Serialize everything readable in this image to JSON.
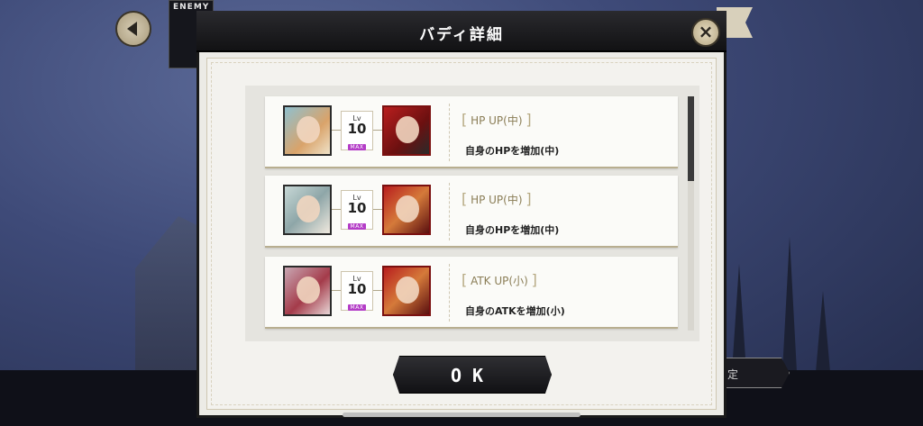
{
  "enemy_label": "ENEMY",
  "dialog": {
    "title": "バディ詳細",
    "close_symbol": "×",
    "ok_label": "OK"
  },
  "side_button_label": "定",
  "buddies": [
    {
      "level_label": "Lv",
      "level": "10",
      "max_badge": "MAX",
      "skill_name": "HP UP(中)",
      "skill_desc": "自身のHPを増加(中)"
    },
    {
      "level_label": "Lv",
      "level": "10",
      "max_badge": "MAX",
      "skill_name": "HP UP(中)",
      "skill_desc": "自身のHPを増加(中)"
    },
    {
      "level_label": "Lv",
      "level": "10",
      "max_badge": "MAX",
      "skill_name": "ATK UP(小)",
      "skill_desc": "自身のATKを増加(小)"
    }
  ],
  "colors": {
    "max_badge": "#b43dc7",
    "skill_name": "#8a7d56",
    "dialog_header": "#121214"
  },
  "icons": {
    "back": "chevron-left-icon",
    "close": "close-icon"
  }
}
